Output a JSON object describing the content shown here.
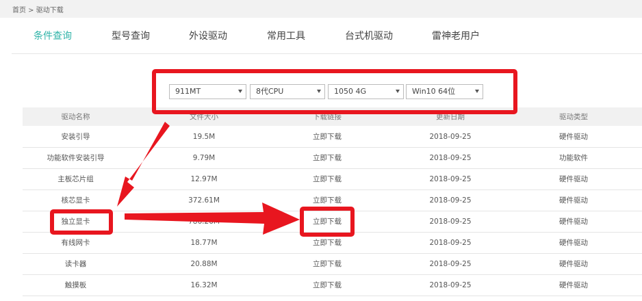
{
  "breadcrumb": "首页 > 驱动下载",
  "tabs": [
    {
      "label": "条件查询",
      "active": true
    },
    {
      "label": "型号查询",
      "active": false
    },
    {
      "label": "外设驱动",
      "active": false
    },
    {
      "label": "常用工具",
      "active": false
    },
    {
      "label": "台式机驱动",
      "active": false
    },
    {
      "label": "雷神老用户",
      "active": false
    }
  ],
  "filters": {
    "model": "911MT",
    "cpu": "8代CPU",
    "gpu": "1050 4G",
    "os": "Win10 64位"
  },
  "table": {
    "headers": [
      "驱动名称",
      "文件大小",
      "下载链接",
      "更新日期",
      "驱动类型"
    ],
    "rows": [
      {
        "name": "安装引导",
        "size": "19.5M",
        "link": "立即下载",
        "date": "2018-09-25",
        "type": "硬件驱动"
      },
      {
        "name": "功能软件安装引导",
        "size": "9.79M",
        "link": "立即下载",
        "date": "2018-09-25",
        "type": "功能软件"
      },
      {
        "name": "主板芯片组",
        "size": "12.97M",
        "link": "立即下载",
        "date": "2018-09-25",
        "type": "硬件驱动"
      },
      {
        "name": "核芯显卡",
        "size": "372.61M",
        "link": "立即下载",
        "date": "2018-09-25",
        "type": "硬件驱动"
      },
      {
        "name": "独立显卡",
        "size": "786.26M",
        "link": "立即下载",
        "date": "2018-09-25",
        "type": "硬件驱动"
      },
      {
        "name": "有线网卡",
        "size": "18.77M",
        "link": "立即下载",
        "date": "2018-09-25",
        "type": "硬件驱动"
      },
      {
        "name": "读卡器",
        "size": "20.88M",
        "link": "立即下载",
        "date": "2018-09-25",
        "type": "硬件驱动"
      },
      {
        "name": "触摸板",
        "size": "16.32M",
        "link": "立即下载",
        "date": "2018-09-25",
        "type": "硬件驱动"
      }
    ]
  },
  "colors": {
    "accent": "#2fb3a8",
    "annotation": "#e8161f"
  }
}
